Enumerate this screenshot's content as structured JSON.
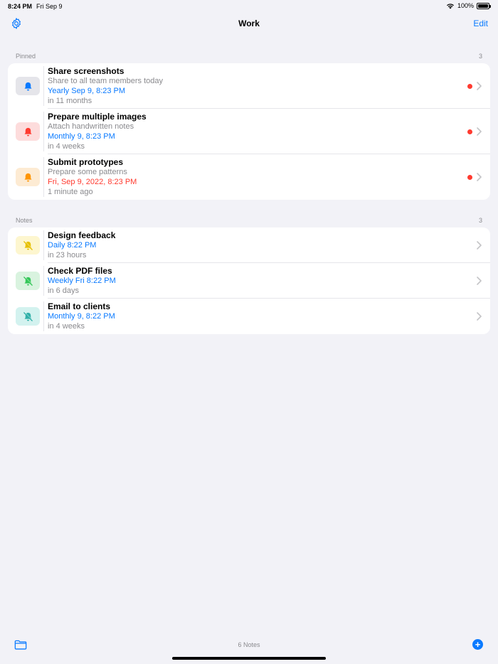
{
  "status": {
    "time": "8:24 PM",
    "date": "Fri Sep 9",
    "battery": "100%"
  },
  "nav": {
    "title": "Work",
    "edit_label": "Edit",
    "left_icon": "gear-icon"
  },
  "sections": [
    {
      "title": "Pinned",
      "count": "3",
      "items": [
        {
          "title": "Share screenshots",
          "subtitle": "Share to all team members today",
          "date": "Yearly  Sep 9, 8:23 PM",
          "relative": "in 11 months",
          "icon": "bell-icon",
          "icon_color": "#0a7aff",
          "icon_bg": "#e5e5ea",
          "dot": true,
          "overdue": false
        },
        {
          "title": "Prepare multiple images",
          "subtitle": "Attach handwritten notes",
          "date": "Monthly  9, 8:23 PM",
          "relative": "in 4 weeks",
          "icon": "bell-icon",
          "icon_color": "#ff3b30",
          "icon_bg": "#fddcdc",
          "dot": true,
          "overdue": false
        },
        {
          "title": "Submit prototypes",
          "subtitle": "Prepare some patterns",
          "date": "Fri, Sep 9, 2022, 8:23 PM",
          "relative": "1 minute ago",
          "icon": "bell-icon",
          "icon_color": "#ff9500",
          "icon_bg": "#fdebd3",
          "dot": true,
          "overdue": true
        }
      ]
    },
    {
      "title": "Notes",
      "count": "3",
      "items": [
        {
          "title": "Design feedback",
          "subtitle": "",
          "date": "Daily  8:22 PM",
          "relative": "in 23 hours",
          "icon": "bell-slash-icon",
          "icon_color": "#e6c000",
          "icon_bg": "#fdf6cf",
          "dot": false,
          "overdue": false
        },
        {
          "title": "Check PDF files",
          "subtitle": "",
          "date": "Weekly  Fri 8:22 PM",
          "relative": "in 6 days",
          "icon": "bell-slash-icon",
          "icon_color": "#34c759",
          "icon_bg": "#d9f3df",
          "dot": false,
          "overdue": false
        },
        {
          "title": "Email to clients",
          "subtitle": "",
          "date": "Monthly  9, 8:22 PM",
          "relative": "in 4 weeks",
          "icon": "bell-slash-icon",
          "icon_color": "#30b0a8",
          "icon_bg": "#d3f2ef",
          "dot": false,
          "overdue": false
        }
      ]
    }
  ],
  "footer": {
    "count_label": "6 Notes",
    "left_icon": "folder-icon",
    "right_icon": "plus-circle-icon"
  }
}
